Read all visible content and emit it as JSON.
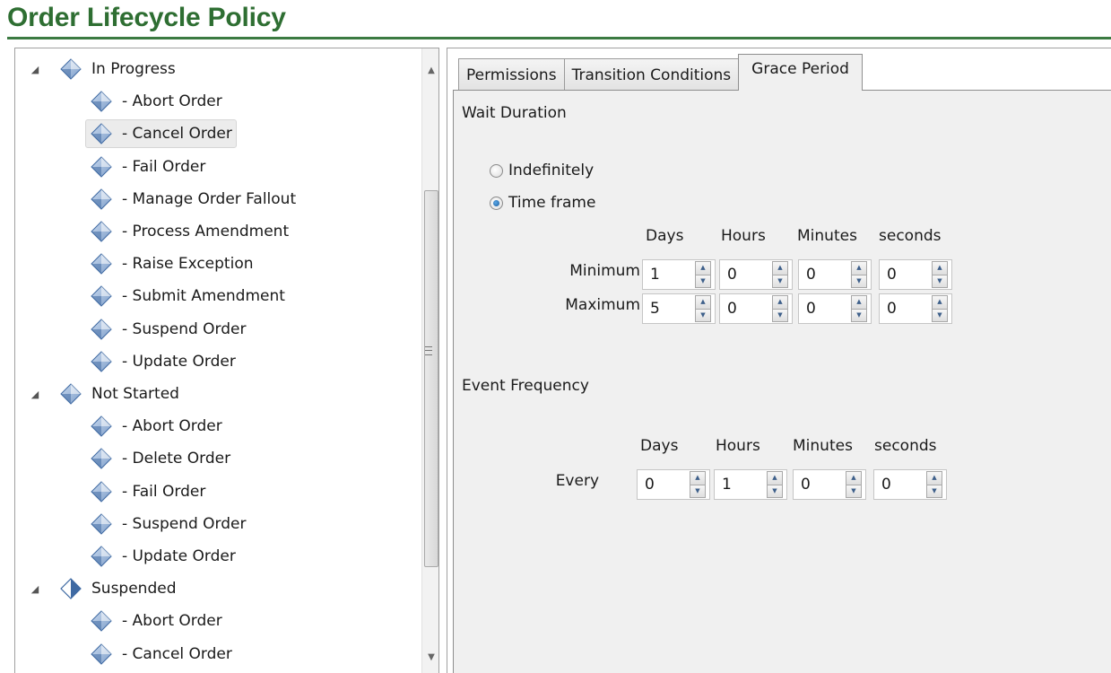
{
  "title": "Order Lifecycle Policy",
  "tree": {
    "items": [
      {
        "label": "In Progress",
        "type": "group"
      },
      {
        "label": "- Abort Order",
        "type": "child"
      },
      {
        "label": "- Cancel Order",
        "type": "child",
        "selected": true
      },
      {
        "label": "- Fail Order",
        "type": "child"
      },
      {
        "label": "- Manage Order Fallout",
        "type": "child"
      },
      {
        "label": "- Process Amendment",
        "type": "child"
      },
      {
        "label": "- Raise Exception",
        "type": "child"
      },
      {
        "label": "- Submit Amendment",
        "type": "child"
      },
      {
        "label": "- Suspend Order",
        "type": "child"
      },
      {
        "label": "- Update Order",
        "type": "child"
      },
      {
        "label": "Not Started",
        "type": "group"
      },
      {
        "label": "- Abort Order",
        "type": "child"
      },
      {
        "label": "- Delete Order",
        "type": "child"
      },
      {
        "label": "- Fail Order",
        "type": "child"
      },
      {
        "label": "- Suspend Order",
        "type": "child"
      },
      {
        "label": "- Update Order",
        "type": "child"
      },
      {
        "label": "Suspended",
        "type": "group",
        "half_diamond": true
      },
      {
        "label": "- Abort Order",
        "type": "child"
      },
      {
        "label": "- Cancel Order",
        "type": "child"
      }
    ],
    "expander_glyph": "◢",
    "scroll_up_glyph": "▲",
    "scroll_down_glyph": "▼"
  },
  "tabs": [
    {
      "label": "Permissions",
      "active": false
    },
    {
      "label": "Transition Conditions",
      "active": false
    },
    {
      "label": "Grace Period",
      "active": true
    }
  ],
  "grace_period": {
    "wait_duration_label": "Wait Duration",
    "radio_indefinitely": "Indefinitely",
    "radio_time_frame": "Time frame",
    "selected_radio": "Time frame",
    "columns": [
      "Days",
      "Hours",
      "Minutes",
      "seconds"
    ],
    "minimum_label": "Minimum",
    "maximum_label": "Maximum",
    "minimum_values": [
      "1",
      "0",
      "0",
      "0"
    ],
    "maximum_values": [
      "5",
      "0",
      "0",
      "0"
    ],
    "event_frequency_label": "Event Frequency",
    "every_label": "Every",
    "every_values": [
      "0",
      "1",
      "0",
      "0"
    ]
  },
  "colors": {
    "title": "#2e6e32",
    "diamond_light": "#c9d9ee",
    "diamond_dark": "#3f6aa3"
  }
}
